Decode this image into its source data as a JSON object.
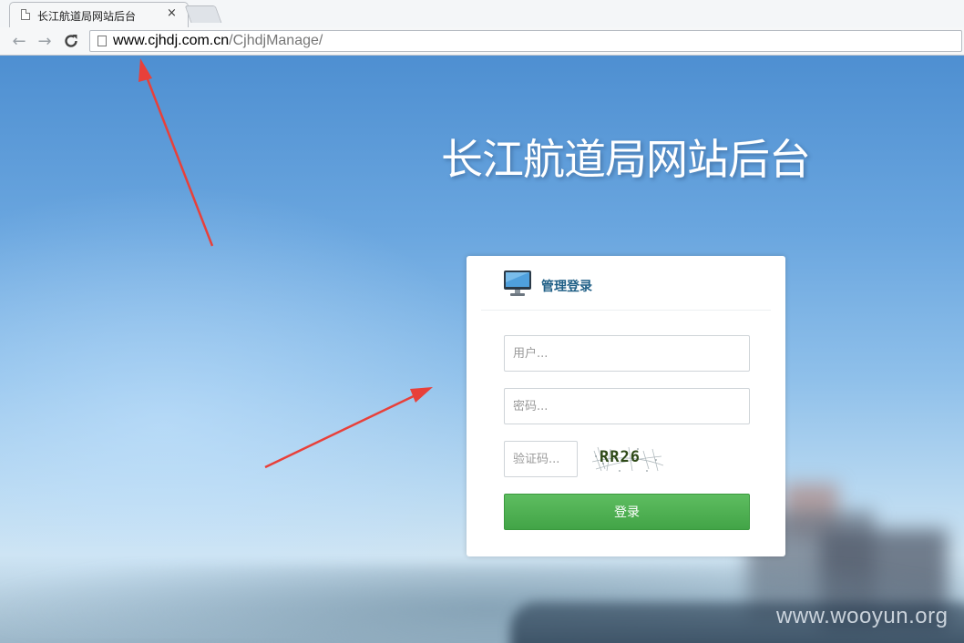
{
  "browser": {
    "tab": {
      "title": "长江航道局网站后台",
      "close_glyph": "×"
    },
    "nav": {
      "back_glyph": "←",
      "forward_glyph": "→",
      "reload_glyph": "C"
    },
    "address": {
      "host": "www.cjhdj.com.cn",
      "path": "/CjhdjManage/"
    }
  },
  "page": {
    "site_title": "长江航道局网站后台",
    "login": {
      "heading": "管理登录",
      "username_placeholder": "用户...",
      "password_placeholder": "密码...",
      "code_placeholder": "验证码...",
      "captcha_text": "RR26",
      "submit_label": "登录"
    }
  },
  "watermark": "www.wooyun.org",
  "colors": {
    "background_sky": "#5a99d8",
    "heading_text": "#1f5f86",
    "button_green": "#4caf50",
    "annotation_arrow": "#e8403a"
  },
  "icons": [
    "page-icon",
    "back-arrow-icon",
    "forward-arrow-icon",
    "reload-icon",
    "monitor-icon",
    "annotation-arrow"
  ]
}
